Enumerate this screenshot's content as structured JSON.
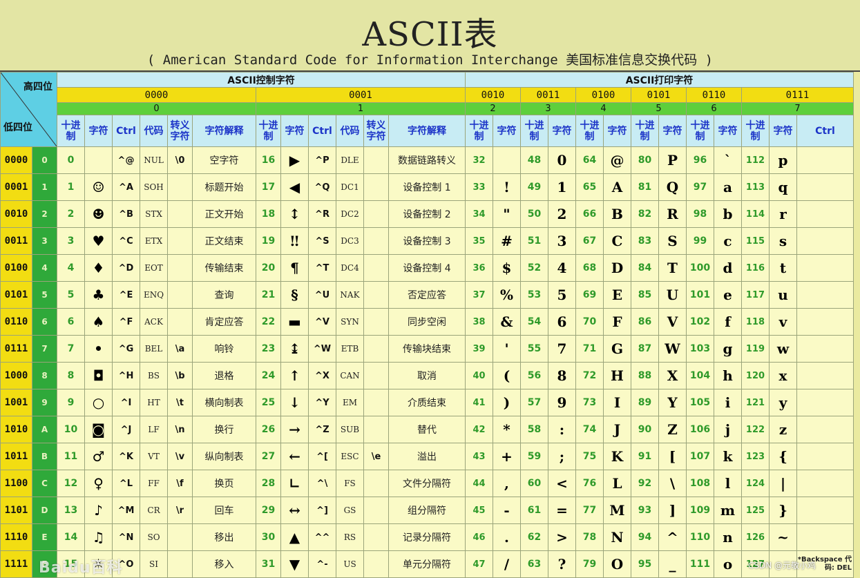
{
  "title": "ASCII表",
  "subtitle": "( American Standard Code for Information Interchange  美国标准信息交换代码 )",
  "corner": {
    "high": "高四位",
    "low": "低四位"
  },
  "sections": {
    "control": "ASCII控制字符",
    "printable": "ASCII打印字符"
  },
  "high_bits": {
    "bin": [
      "0000",
      "0001",
      "0010",
      "0011",
      "0100",
      "0101",
      "0110",
      "0111"
    ],
    "hex": [
      "0",
      "1",
      "2",
      "3",
      "4",
      "5",
      "6",
      "7"
    ]
  },
  "column_headers": {
    "dec": "十进制",
    "char": "字符",
    "ctrl": "Ctrl",
    "code": "代码",
    "escape": "转义字符",
    "desc": "字符解释"
  },
  "rows": [
    {
      "bin": "0000",
      "hex": "0",
      "g0": {
        "dec": "0",
        "char": "",
        "ctrl": "^@",
        "code": "NUL",
        "esc": "\\0",
        "desc": "空字符"
      },
      "g1": {
        "dec": "16",
        "char": "▶",
        "ctrl": "^P",
        "code": "DLE",
        "esc": "",
        "desc": "数据链路转义"
      },
      "p": [
        [
          "32",
          ""
        ],
        [
          "48",
          "0"
        ],
        [
          "64",
          "@"
        ],
        [
          "80",
          "P"
        ],
        [
          "96",
          "`"
        ],
        [
          "112",
          "p"
        ]
      ]
    },
    {
      "bin": "0001",
      "hex": "1",
      "g0": {
        "dec": "1",
        "char": "☺",
        "ctrl": "^A",
        "code": "SOH",
        "esc": "",
        "desc": "标题开始"
      },
      "g1": {
        "dec": "17",
        "char": "◀",
        "ctrl": "^Q",
        "code": "DC1",
        "esc": "",
        "desc": "设备控制 1"
      },
      "p": [
        [
          "33",
          "!"
        ],
        [
          "49",
          "1"
        ],
        [
          "65",
          "A"
        ],
        [
          "81",
          "Q"
        ],
        [
          "97",
          "a"
        ],
        [
          "113",
          "q"
        ]
      ]
    },
    {
      "bin": "0010",
      "hex": "2",
      "g0": {
        "dec": "2",
        "char": "☻",
        "ctrl": "^B",
        "code": "STX",
        "esc": "",
        "desc": "正文开始"
      },
      "g1": {
        "dec": "18",
        "char": "↕",
        "ctrl": "^R",
        "code": "DC2",
        "esc": "",
        "desc": "设备控制 2"
      },
      "p": [
        [
          "34",
          "\""
        ],
        [
          "50",
          "2"
        ],
        [
          "66",
          "B"
        ],
        [
          "82",
          "R"
        ],
        [
          "98",
          "b"
        ],
        [
          "114",
          "r"
        ]
      ]
    },
    {
      "bin": "0011",
      "hex": "3",
      "g0": {
        "dec": "3",
        "char": "♥",
        "ctrl": "^C",
        "code": "ETX",
        "esc": "",
        "desc": "正文结束"
      },
      "g1": {
        "dec": "19",
        "char": "‼",
        "ctrl": "^S",
        "code": "DC3",
        "esc": "",
        "desc": "设备控制 3"
      },
      "p": [
        [
          "35",
          "#"
        ],
        [
          "51",
          "3"
        ],
        [
          "67",
          "C"
        ],
        [
          "83",
          "S"
        ],
        [
          "99",
          "c"
        ],
        [
          "115",
          "s"
        ]
      ]
    },
    {
      "bin": "0100",
      "hex": "4",
      "g0": {
        "dec": "4",
        "char": "♦",
        "ctrl": "^D",
        "code": "EOT",
        "esc": "",
        "desc": "传输结束"
      },
      "g1": {
        "dec": "20",
        "char": "¶",
        "ctrl": "^T",
        "code": "DC4",
        "esc": "",
        "desc": "设备控制 4"
      },
      "p": [
        [
          "36",
          "$"
        ],
        [
          "52",
          "4"
        ],
        [
          "68",
          "D"
        ],
        [
          "84",
          "T"
        ],
        [
          "100",
          "d"
        ],
        [
          "116",
          "t"
        ]
      ]
    },
    {
      "bin": "0101",
      "hex": "5",
      "g0": {
        "dec": "5",
        "char": "♣",
        "ctrl": "^E",
        "code": "ENQ",
        "esc": "",
        "desc": "查询"
      },
      "g1": {
        "dec": "21",
        "char": "§",
        "ctrl": "^U",
        "code": "NAK",
        "esc": "",
        "desc": "否定应答"
      },
      "p": [
        [
          "37",
          "%"
        ],
        [
          "53",
          "5"
        ],
        [
          "69",
          "E"
        ],
        [
          "85",
          "U"
        ],
        [
          "101",
          "e"
        ],
        [
          "117",
          "u"
        ]
      ]
    },
    {
      "bin": "0110",
      "hex": "6",
      "g0": {
        "dec": "6",
        "char": "♠",
        "ctrl": "^F",
        "code": "ACK",
        "esc": "",
        "desc": "肯定应答"
      },
      "g1": {
        "dec": "22",
        "char": "▬",
        "ctrl": "^V",
        "code": "SYN",
        "esc": "",
        "desc": "同步空闲"
      },
      "p": [
        [
          "38",
          "&"
        ],
        [
          "54",
          "6"
        ],
        [
          "70",
          "F"
        ],
        [
          "86",
          "V"
        ],
        [
          "102",
          "f"
        ],
        [
          "118",
          "v"
        ]
      ]
    },
    {
      "bin": "0111",
      "hex": "7",
      "g0": {
        "dec": "7",
        "char": "•",
        "ctrl": "^G",
        "code": "BEL",
        "esc": "\\a",
        "desc": "响铃"
      },
      "g1": {
        "dec": "23",
        "char": "↨",
        "ctrl": "^W",
        "code": "ETB",
        "esc": "",
        "desc": "传输块结束"
      },
      "p": [
        [
          "39",
          "'"
        ],
        [
          "55",
          "7"
        ],
        [
          "71",
          "G"
        ],
        [
          "87",
          "W"
        ],
        [
          "103",
          "g"
        ],
        [
          "119",
          "w"
        ]
      ]
    },
    {
      "bin": "1000",
      "hex": "8",
      "g0": {
        "dec": "8",
        "char": "◘",
        "ctrl": "^H",
        "code": "BS",
        "esc": "\\b",
        "desc": "退格"
      },
      "g1": {
        "dec": "24",
        "char": "↑",
        "ctrl": "^X",
        "code": "CAN",
        "esc": "",
        "desc": "取消"
      },
      "p": [
        [
          "40",
          "("
        ],
        [
          "56",
          "8"
        ],
        [
          "72",
          "H"
        ],
        [
          "88",
          "X"
        ],
        [
          "104",
          "h"
        ],
        [
          "120",
          "x"
        ]
      ]
    },
    {
      "bin": "1001",
      "hex": "9",
      "g0": {
        "dec": "9",
        "char": "○",
        "ctrl": "^I",
        "code": "HT",
        "esc": "\\t",
        "desc": "横向制表"
      },
      "g1": {
        "dec": "25",
        "char": "↓",
        "ctrl": "^Y",
        "code": "EM",
        "esc": "",
        "desc": "介质结束"
      },
      "p": [
        [
          "41",
          ")"
        ],
        [
          "57",
          "9"
        ],
        [
          "73",
          "I"
        ],
        [
          "89",
          "Y"
        ],
        [
          "105",
          "i"
        ],
        [
          "121",
          "y"
        ]
      ]
    },
    {
      "bin": "1010",
      "hex": "A",
      "g0": {
        "dec": "10",
        "char": "◙",
        "ctrl": "^J",
        "code": "LF",
        "esc": "\\n",
        "desc": "换行"
      },
      "g1": {
        "dec": "26",
        "char": "→",
        "ctrl": "^Z",
        "code": "SUB",
        "esc": "",
        "desc": "替代"
      },
      "p": [
        [
          "42",
          "*"
        ],
        [
          "58",
          ":"
        ],
        [
          "74",
          "J"
        ],
        [
          "90",
          "Z"
        ],
        [
          "106",
          "j"
        ],
        [
          "122",
          "z"
        ]
      ]
    },
    {
      "bin": "1011",
      "hex": "B",
      "g0": {
        "dec": "11",
        "char": "♂",
        "ctrl": "^K",
        "code": "VT",
        "esc": "\\v",
        "desc": "纵向制表"
      },
      "g1": {
        "dec": "27",
        "char": "←",
        "ctrl": "^[",
        "code": "ESC",
        "esc": "\\e",
        "desc": "溢出"
      },
      "p": [
        [
          "43",
          "+"
        ],
        [
          "59",
          ";"
        ],
        [
          "75",
          "K"
        ],
        [
          "91",
          "["
        ],
        [
          "107",
          "k"
        ],
        [
          "123",
          "{"
        ]
      ]
    },
    {
      "bin": "1100",
      "hex": "C",
      "g0": {
        "dec": "12",
        "char": "♀",
        "ctrl": "^L",
        "code": "FF",
        "esc": "\\f",
        "desc": "换页"
      },
      "g1": {
        "dec": "28",
        "char": "∟",
        "ctrl": "^\\",
        "code": "FS",
        "esc": "",
        "desc": "文件分隔符"
      },
      "p": [
        [
          "44",
          ","
        ],
        [
          "60",
          "<"
        ],
        [
          "76",
          "L"
        ],
        [
          "92",
          "\\"
        ],
        [
          "108",
          "l"
        ],
        [
          "124",
          "|"
        ]
      ]
    },
    {
      "bin": "1101",
      "hex": "D",
      "g0": {
        "dec": "13",
        "char": "♪",
        "ctrl": "^M",
        "code": "CR",
        "esc": "\\r",
        "desc": "回车"
      },
      "g1": {
        "dec": "29",
        "char": "↔",
        "ctrl": "^]",
        "code": "GS",
        "esc": "",
        "desc": "组分隔符"
      },
      "p": [
        [
          "45",
          "-"
        ],
        [
          "61",
          "="
        ],
        [
          "77",
          "M"
        ],
        [
          "93",
          "]"
        ],
        [
          "109",
          "m"
        ],
        [
          "125",
          "}"
        ]
      ]
    },
    {
      "bin": "1110",
      "hex": "E",
      "g0": {
        "dec": "14",
        "char": "♫",
        "ctrl": "^N",
        "code": "SO",
        "esc": "",
        "desc": "移出"
      },
      "g1": {
        "dec": "30",
        "char": "▲",
        "ctrl": "^^",
        "code": "RS",
        "esc": "",
        "desc": "记录分隔符"
      },
      "p": [
        [
          "46",
          "."
        ],
        [
          "62",
          ">"
        ],
        [
          "78",
          "N"
        ],
        [
          "94",
          "^"
        ],
        [
          "110",
          "n"
        ],
        [
          "126",
          "~"
        ]
      ]
    },
    {
      "bin": "1111",
      "hex": "F",
      "g0": {
        "dec": "15",
        "char": "☼",
        "ctrl": "^O",
        "code": "SI",
        "esc": "",
        "desc": "移入"
      },
      "g1": {
        "dec": "31",
        "char": "▼",
        "ctrl": "^-",
        "code": "US",
        "esc": "",
        "desc": "单元分隔符"
      },
      "p": [
        [
          "47",
          "/"
        ],
        [
          "63",
          "?"
        ],
        [
          "79",
          "O"
        ],
        [
          "95",
          "_"
        ],
        [
          "111",
          "o"
        ],
        [
          "127",
          ""
        ]
      ]
    }
  ],
  "last_row_note": "*Backspace 代码: DEL",
  "watermarks": {
    "left": "Baidu百科",
    "right": "CSDN @元敬小鸡"
  }
}
